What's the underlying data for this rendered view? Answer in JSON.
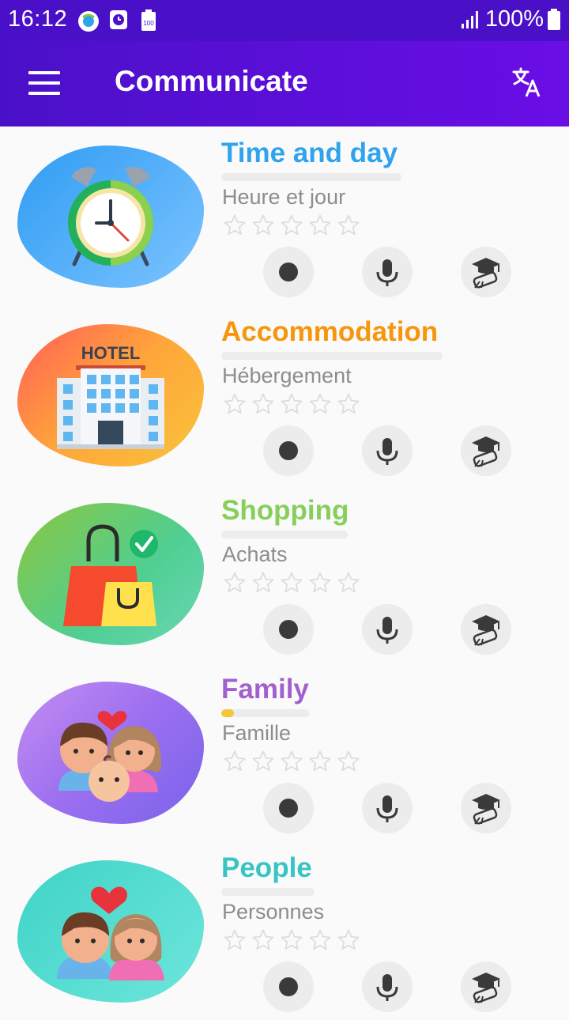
{
  "status_bar": {
    "time": "16:12",
    "battery_percent": "100%",
    "battery_badge": "100",
    "icons": [
      "browser-icon",
      "clock-app-icon",
      "battery-saver-icon",
      "signal-icon",
      "battery-icon"
    ]
  },
  "app_bar": {
    "title": "Communicate",
    "icons": [
      "menu-icon",
      "translate-icon"
    ]
  },
  "categories": [
    {
      "title": "Time and day",
      "subtitle": "Heure et jour",
      "color": "#2fa3ee",
      "progress": 0,
      "stars": 0,
      "max_stars": 5,
      "icon": "alarm-clock-icon"
    },
    {
      "title": "Accommodation",
      "subtitle": "Hébergement",
      "color": "#f5960c",
      "progress": 0,
      "stars": 0,
      "max_stars": 5,
      "icon": "hotel-icon",
      "icon_text": "HOTEL"
    },
    {
      "title": "Shopping",
      "subtitle": "Achats",
      "color": "#86cf5a",
      "progress": 0,
      "stars": 0,
      "max_stars": 5,
      "icon": "shopping-bags-icon"
    },
    {
      "title": "Family",
      "subtitle": "Famille",
      "color": "#a15fd0",
      "progress": 0.07,
      "stars": 0,
      "max_stars": 5,
      "icon": "family-icon"
    },
    {
      "title": "People",
      "subtitle": "Personnes",
      "color": "#36c4c4",
      "progress": 0,
      "stars": 0,
      "max_stars": 5,
      "icon": "couple-icon"
    }
  ],
  "item_actions": [
    "record-icon",
    "microphone-icon",
    "graduation-icon"
  ]
}
